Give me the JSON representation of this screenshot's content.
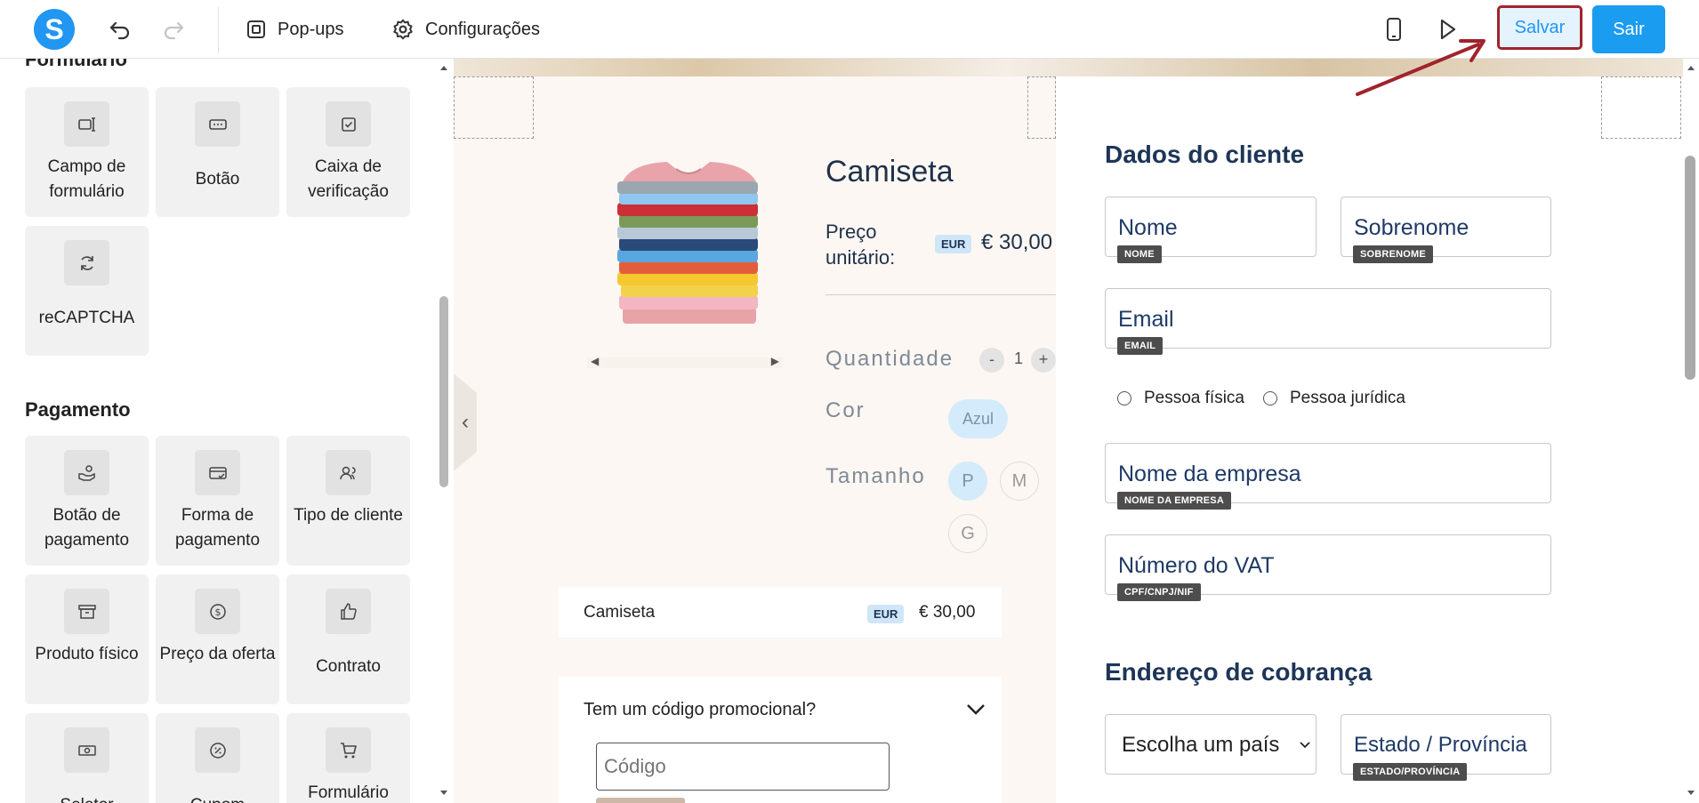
{
  "topbar": {
    "logo_letter": "S",
    "popups_label": "Pop-ups",
    "settings_label": "Configurações",
    "save_label": "Salvar",
    "exit_label": "Sair"
  },
  "sidebar": {
    "form_section_title": "Formulário",
    "form_items": [
      {
        "label": "Campo de formulário",
        "icon": "form-field-icon"
      },
      {
        "label": "Botão",
        "icon": "button-icon"
      },
      {
        "label": "Caixa de verificação",
        "icon": "checkbox-icon"
      },
      {
        "label": "reCAPTCHA",
        "icon": "recaptcha-icon"
      }
    ],
    "payment_section_title": "Pagamento",
    "payment_items": [
      {
        "label": "Botão de pagamento",
        "icon": "hand-coin-icon"
      },
      {
        "label": "Forma de pagamento",
        "icon": "card-icon"
      },
      {
        "label": "Tipo de cliente",
        "icon": "users-icon"
      },
      {
        "label": "Produto físico",
        "icon": "archive-box-icon"
      },
      {
        "label": "Preço da oferta",
        "icon": "dollar-coin-icon"
      },
      {
        "label": "Contrato",
        "icon": "thumbs-up-icon"
      },
      {
        "label": "Seletor",
        "icon": "banknote-icon"
      },
      {
        "label": "Cupom",
        "icon": "discount-icon"
      },
      {
        "label": "Formulário",
        "icon": "cart-icon"
      }
    ]
  },
  "product": {
    "title": "Camiseta",
    "unit_price_label": "Preço unitário:",
    "currency_badge": "EUR",
    "unit_price": "€ 30,00",
    "quantity_label": "Quantidade",
    "quantity_minus": "-",
    "quantity_value": "1",
    "quantity_plus": "+",
    "color_label": "Cor",
    "color_option": "Azul",
    "size_label": "Tamanho",
    "sizes": [
      "P",
      "M",
      "G"
    ],
    "summary_name": "Camiseta",
    "summary_price": "€ 30,00",
    "promo_question": "Tem um código promocional?",
    "promo_placeholder": "Código"
  },
  "customer": {
    "section_title": "Dados do cliente",
    "first_name": "Nome",
    "first_name_tag": "NOME",
    "last_name": "Sobrenome",
    "last_name_tag": "SOBRENOME",
    "email": "Email",
    "email_tag": "EMAIL",
    "person_option": "Pessoa física",
    "company_option": "Pessoa jurídica",
    "company_name": "Nome da empresa",
    "company_name_tag": "NOME DA EMPRESA",
    "vat": "Número do VAT",
    "vat_tag": "CPF/CNPJ/NIF",
    "billing_title": "Endereço de cobrança",
    "country_select": "Escolha um país",
    "state": "Estado / Província",
    "state_tag": "ESTADO/PROVÍNCIA"
  },
  "colors": {
    "accent": "#2196f3",
    "save_border": "#a1232c",
    "heading": "#1d3557"
  }
}
